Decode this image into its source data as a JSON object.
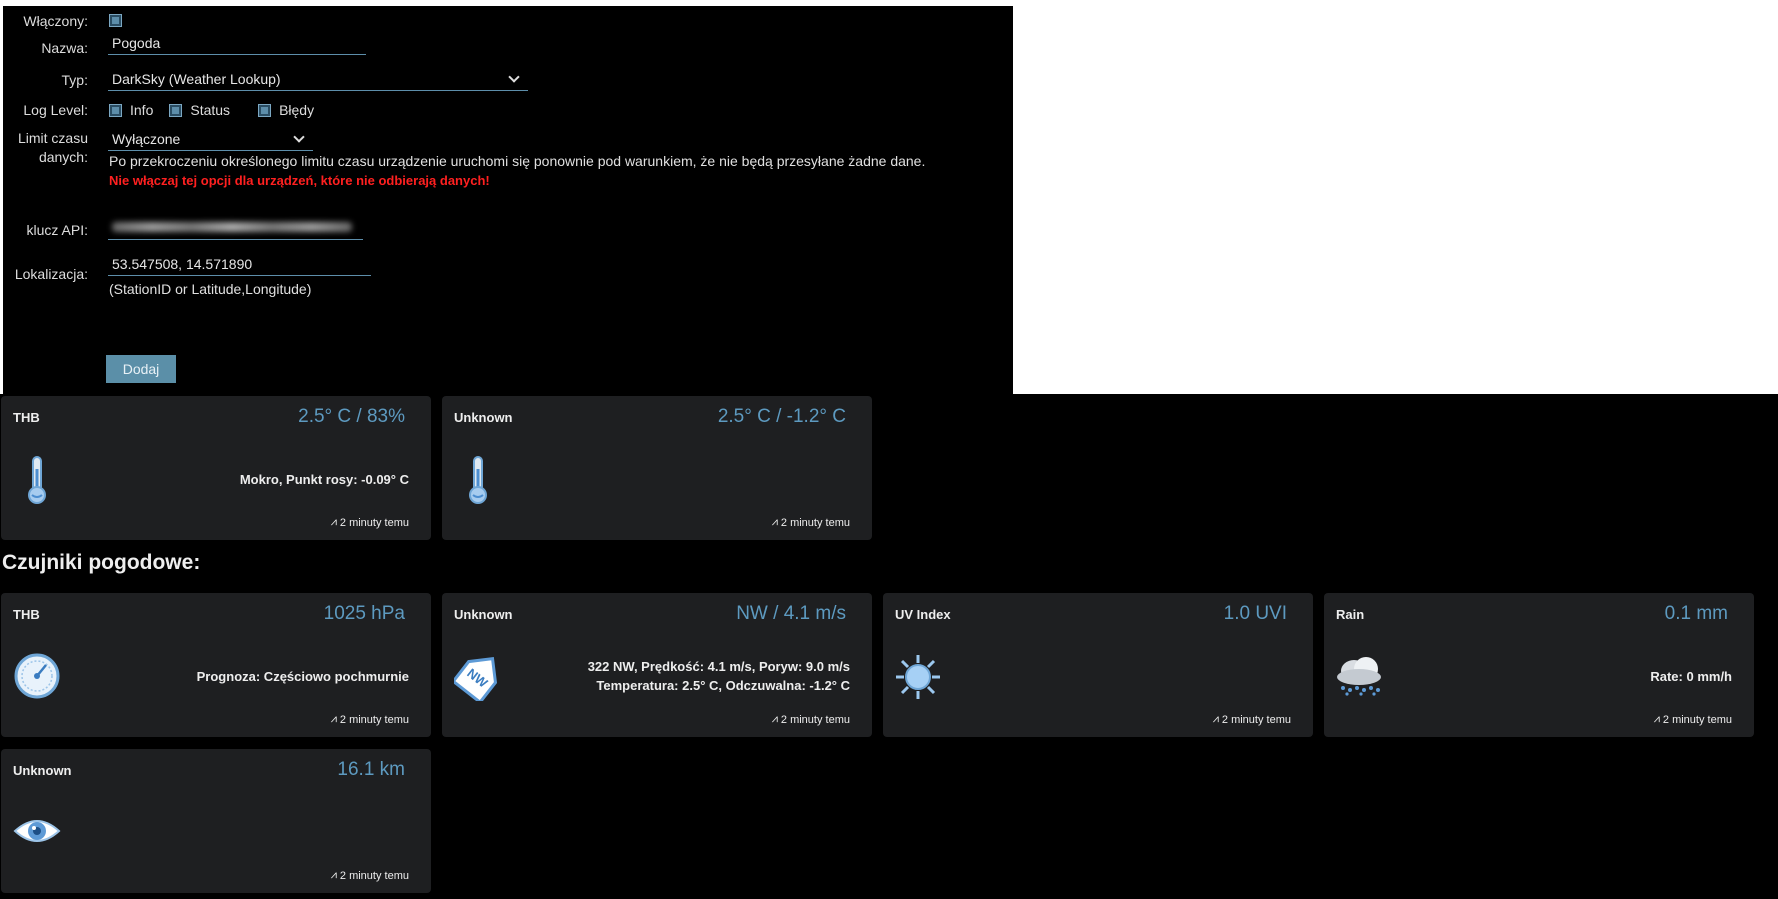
{
  "form": {
    "enabled_label": "Włączony:",
    "name_label": "Nazwa:",
    "name_value": "Pogoda",
    "type_label": "Typ:",
    "type_value": "DarkSky (Weather Lookup)",
    "log_level_label": "Log Level:",
    "log_options": [
      "Info",
      "Status",
      "Błędy"
    ],
    "timeout_label_1": "Limit czasu",
    "timeout_label_2": "danych:",
    "timeout_value": "Wyłączone",
    "timeout_info": "Po przekroczeniu określonego limitu czasu urządzenie uruchomi się ponownie pod warunkiem, że nie będą przesyłane żadne dane.",
    "timeout_warning": "Nie włączaj tej opcji dla urządzeń, które nie odbierają danych!",
    "api_key_label": "klucz API:",
    "location_label": "Lokalizacja:",
    "location_value": "53.547508, 14.571890",
    "location_hint": "(StationID or Latitude,Longitude)",
    "add_button": "Dodaj"
  },
  "section_title": "Czujniki pogodowe:",
  "top_cards": [
    {
      "title": "THB",
      "value": "2.5° C / 83%",
      "detail": "Mokro, Punkt rosy: -0.09° C",
      "time": "2 minuty temu",
      "icon": "thermometer-icon"
    },
    {
      "title": "Unknown",
      "value": "2.5° C / -1.2° C",
      "detail": "",
      "time": "2 minuty temu",
      "icon": "thermometer-icon"
    }
  ],
  "weather_cards": [
    {
      "title": "THB",
      "value": "1025 hPa",
      "detail": "Prognoza: Częściowo pochmurnie",
      "detail2": "",
      "time": "2 minuty temu",
      "icon": "barometer-icon"
    },
    {
      "title": "Unknown",
      "value": "NW / 4.1 m/s",
      "detail": "322 NW, Prędkość: 4.1 m/s, Poryw: 9.0 m/s",
      "detail2": "Temperatura: 2.5° C, Odczuwalna: -1.2° C",
      "time": "2 minuty temu",
      "icon": "wind-direction-icon",
      "icon_text": "NW"
    },
    {
      "title": "UV Index",
      "value": "1.0 UVI",
      "detail": "",
      "detail2": "",
      "time": "2 minuty temu",
      "icon": "sun-icon"
    },
    {
      "title": "Rain",
      "value": "0.1 mm",
      "detail": "Rate: 0 mm/h",
      "detail2": "",
      "time": "2 minuty temu",
      "icon": "rain-cloud-icon"
    },
    {
      "title": "Unknown",
      "value": "16.1 km",
      "detail": "",
      "detail2": "",
      "time": "2 minuty temu",
      "icon": "eye-icon"
    }
  ],
  "colors": {
    "accent": "#5d9ac0",
    "card_bg": "#1e1f21",
    "warning": "#ff2020",
    "button": "#5b8fa8"
  }
}
